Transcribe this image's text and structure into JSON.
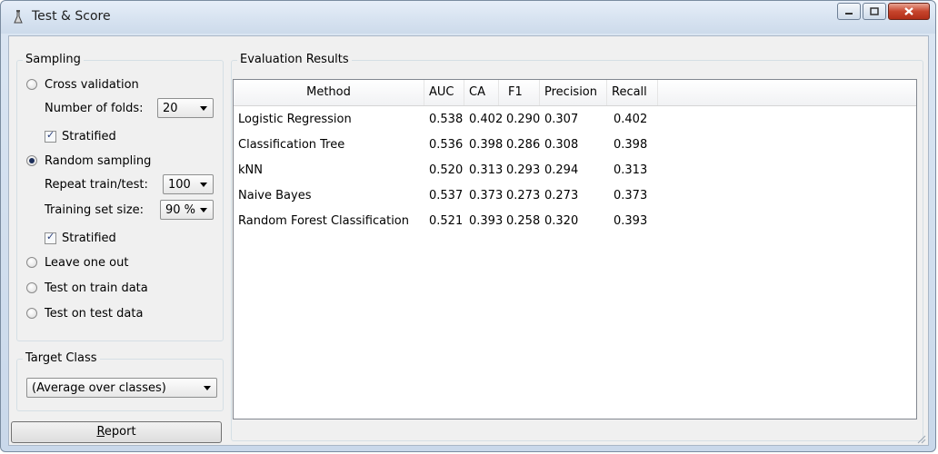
{
  "window": {
    "title": "Test & Score",
    "controls": [
      "minimize-icon",
      "maximize-icon",
      "close-icon"
    ]
  },
  "sampling": {
    "title": "Sampling",
    "cross_validation": "Cross validation",
    "number_of_folds_label": "Number of folds:",
    "number_of_folds_value": "20",
    "stratified_label": "Stratified",
    "random_sampling": "Random sampling",
    "repeat_label": "Repeat train/test:",
    "repeat_value": "100",
    "training_size_label": "Training set size:",
    "training_size_value": "90 %",
    "leave_one_out": "Leave one out",
    "test_on_train": "Test on train data",
    "test_on_test": "Test on test data",
    "selected": "random_sampling"
  },
  "target_class": {
    "title": "Target Class",
    "value": "(Average over classes)"
  },
  "report": {
    "label_underlined": "R",
    "label_rest": "eport"
  },
  "results": {
    "title": "Evaluation Results",
    "columns": [
      "Method",
      "AUC",
      "CA",
      "F1",
      "Precision",
      "Recall"
    ],
    "rows": [
      [
        "Logistic Regression",
        "0.538",
        "0.402",
        "0.290",
        "0.307",
        "0.402"
      ],
      [
        "Classification Tree",
        "0.536",
        "0.398",
        "0.286",
        "0.308",
        "0.398"
      ],
      [
        "kNN",
        "0.520",
        "0.313",
        "0.293",
        "0.294",
        "0.313"
      ],
      [
        "Naive Bayes",
        "0.537",
        "0.373",
        "0.273",
        "0.273",
        "0.373"
      ],
      [
        "Random Forest Classification",
        "0.521",
        "0.393",
        "0.258",
        "0.320",
        "0.393"
      ]
    ]
  }
}
